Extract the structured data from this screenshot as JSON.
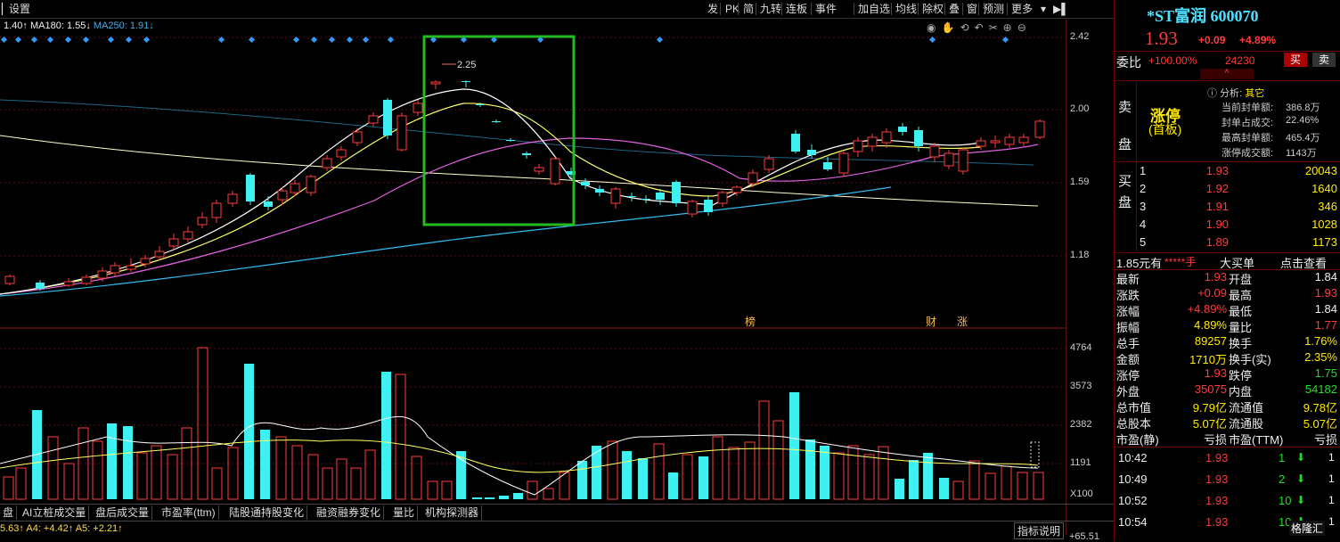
{
  "toolbar": {
    "left_label": "设置",
    "items": [
      "发",
      "PK",
      "简",
      "九转",
      "连板",
      "事件",
      "加自选",
      "均线",
      "除权",
      "叠",
      "窗",
      "预测",
      "更多"
    ]
  },
  "ma_line": {
    "ma1": "1.40↑",
    "ma180": "MA180: 1.55↓",
    "ma250": "MA250: 1.91↓"
  },
  "price_axis": [
    "2.42",
    "2.00",
    "1.59",
    "1.18"
  ],
  "volume_axis": [
    "4764",
    "3573",
    "2382",
    "1191",
    "X100"
  ],
  "annotations": {
    "high_marker": "2.25",
    "event_bang": "榜",
    "event_cai": "财",
    "event_zhang": "涨"
  },
  "bottom_tabs": [
    "盘",
    "AI立桩成交量",
    "盘后成交量",
    "市盈率(ttm)",
    "陆股通持股变化",
    "融资融券变化",
    "量比",
    "机构探测器"
  ],
  "status": {
    "ma_readout": "5.63↑ A4: +4.42↑ A5: +2.21↑",
    "help": "指标说明",
    "bottom_value": "+65.51"
  },
  "quote": {
    "name": "*ST富润 600070",
    "price": "1.93",
    "change": "+0.09",
    "change_pct": "+4.89%",
    "weibi_label": "委比",
    "weibi": "+100.00%",
    "weicha": "24230",
    "buy_btn": "买",
    "sell_btn": "卖",
    "sell_side_label": "卖盘",
    "limit_title": "涨停",
    "limit_sub": "(首板)",
    "analysis_label": "分析:",
    "analysis_value": "其它",
    "limit_stats": [
      {
        "k": "当前封单额:",
        "v": "386.8万"
      },
      {
        "k": "封单占成交:",
        "v": "22.46%"
      },
      {
        "k": "最高封单额:",
        "v": "465.4万"
      },
      {
        "k": "涨停成交额:",
        "v": "1143万"
      }
    ],
    "buy_side_label": "买盘",
    "bids": [
      {
        "lvl": "1",
        "price": "1.93",
        "vol": "20043"
      },
      {
        "lvl": "2",
        "price": "1.92",
        "vol": "1640"
      },
      {
        "lvl": "3",
        "price": "1.91",
        "vol": "346"
      },
      {
        "lvl": "4",
        "price": "1.90",
        "vol": "1028"
      },
      {
        "lvl": "5",
        "price": "1.89",
        "vol": "1173"
      }
    ],
    "bigorder": {
      "a": "1.85元有",
      "b": "*****手",
      "c": "大买单",
      "d": "点击查看"
    },
    "stats": [
      {
        "k1": "最新",
        "v1": "1.93",
        "c1": "red",
        "k2": "开盘",
        "v2": "1.84",
        "c2": "white"
      },
      {
        "k1": "涨跌",
        "v1": "+0.09",
        "c1": "red",
        "k2": "最高",
        "v2": "1.93",
        "c2": "red"
      },
      {
        "k1": "涨幅",
        "v1": "+4.89%",
        "c1": "red",
        "k2": "最低",
        "v2": "1.84",
        "c2": "white"
      },
      {
        "k1": "振幅",
        "v1": "4.89%",
        "c1": "yellow",
        "k2": "量比",
        "v2": "1.77",
        "c2": "red"
      },
      {
        "k1": "总手",
        "v1": "89257",
        "c1": "yellow",
        "k2": "换手",
        "v2": "1.76%",
        "c2": "yellow"
      },
      {
        "k1": "金额",
        "v1": "1710万",
        "c1": "yellow",
        "k2": "换手(实)",
        "v2": "2.35%",
        "c2": "yellow"
      },
      {
        "k1": "涨停",
        "v1": "1.93",
        "c1": "red",
        "k2": "跌停",
        "v2": "1.75",
        "c2": "green"
      },
      {
        "k1": "外盘",
        "v1": "35075",
        "c1": "red",
        "k2": "内盘",
        "v2": "54182",
        "c2": "green"
      },
      {
        "k1": "总市值",
        "v1": "9.79亿",
        "c1": "yellow",
        "k2": "流通值",
        "v2": "9.78亿",
        "c2": "yellow"
      },
      {
        "k1": "总股本",
        "v1": "5.07亿",
        "c1": "yellow",
        "k2": "流通股",
        "v2": "5.07亿",
        "c2": "yellow"
      },
      {
        "k1": "市盈(静)",
        "v1": "亏损",
        "c1": "white",
        "k2": "市盈(TTM)",
        "v2": "亏损",
        "c2": "white"
      }
    ],
    "ticks": [
      {
        "t": "10:42",
        "p": "1.93",
        "v": "1"
      },
      {
        "t": "10:49",
        "p": "1.93",
        "v": "2"
      },
      {
        "t": "10:52",
        "p": "1.93",
        "v": "10"
      },
      {
        "t": "10:54",
        "p": "1.93",
        "v": "10"
      }
    ],
    "watermark": "格隆汇"
  },
  "colors": {
    "up": "#ff3b3b",
    "down": "#3ff0f0",
    "ma5": "#ffffff",
    "ma10": "#ffff66",
    "ma20": "#e060e0",
    "ma60": "#33bbee",
    "highlight_box": "#22bb22"
  }
}
